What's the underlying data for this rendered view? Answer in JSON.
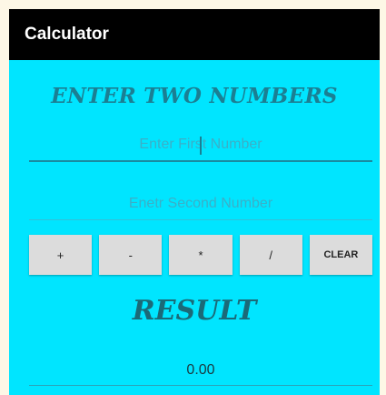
{
  "app": {
    "title": "Calculator"
  },
  "main": {
    "heading": "ENTER TWO NUMBERS",
    "first_input": {
      "value": "",
      "placeholder": "Enter First Number"
    },
    "second_input": {
      "value": "",
      "placeholder": "Enetr Second Number"
    },
    "buttons": [
      {
        "label": "+"
      },
      {
        "label": "-"
      },
      {
        "label": "*"
      },
      {
        "label": "/"
      },
      {
        "label": "CLEAR"
      }
    ],
    "result_title": "RESULT",
    "result_value": "0.00"
  },
  "colors": {
    "accent": "#00e5ff",
    "appbar": "#000000",
    "heading": "#1b7f93",
    "button": "#dcdcdc"
  }
}
